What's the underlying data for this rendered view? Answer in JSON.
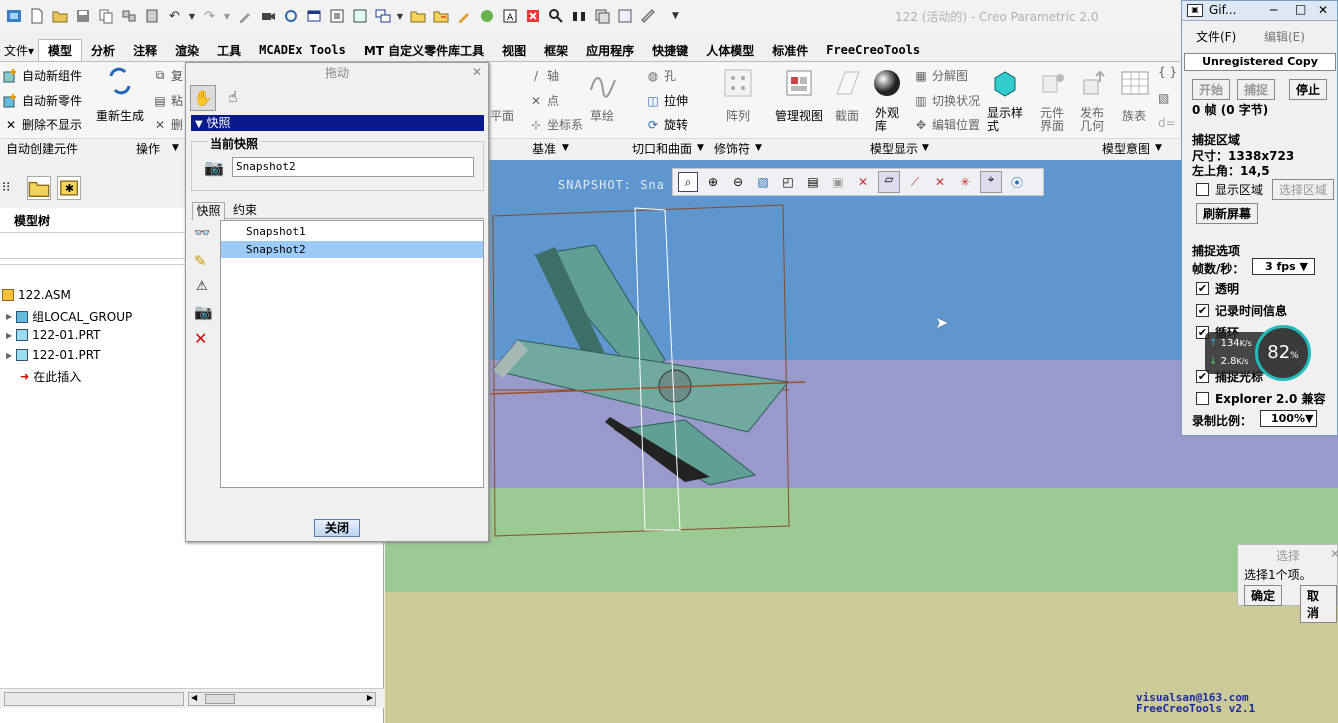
{
  "window": {
    "title": "122 (活动的) - Creo Parametric 2.0"
  },
  "tabs": [
    {
      "label": "文件▾"
    },
    {
      "label": "模型"
    },
    {
      "label": "分析"
    },
    {
      "label": "注释"
    },
    {
      "label": "渲染"
    },
    {
      "label": "工具"
    },
    {
      "label": "MCADEx Tools"
    },
    {
      "label": "MT 自定义零件库工具"
    },
    {
      "label": "视图"
    },
    {
      "label": "框架"
    },
    {
      "label": "应用程序"
    },
    {
      "label": "快捷键"
    },
    {
      "label": "人体模型"
    },
    {
      "label": "标准件"
    },
    {
      "label": "FreeCreoTools"
    }
  ],
  "ribbon": {
    "auto_new_component": "自动新组件",
    "auto_new_part": "自动新零件",
    "delete_hide": "删除不显示",
    "regenerate": "重新生成",
    "copy": "复",
    "paste": "粘",
    "delete": "删",
    "plane": "平面",
    "axis": "轴",
    "point": "点",
    "csys": "坐标系",
    "sketch": "草绘",
    "hole": "孔",
    "extrude": "拉伸",
    "revolve": "旋转",
    "pattern": "阵列",
    "manage_views": "管理视图",
    "section": "截面",
    "appearance": "外观库",
    "explode": "分解图",
    "toggle_status": "切换状况",
    "edit_position": "编辑位置",
    "display_style": "显示样式",
    "component_interface": "元件界面",
    "publish_geometry": "发布几何",
    "family_table": "族表",
    "d_eq": "d="
  },
  "groups": {
    "auto_create": "自动创建元件",
    "operations": "操作",
    "datum": "基准",
    "cut_surface": "切口和曲面",
    "modifiers": "修饰符",
    "model_display": "模型显示",
    "model_intent": "模型意图"
  },
  "left_panel": {
    "model_tree_label": "模型树",
    "items": [
      {
        "label": "122.ASM"
      },
      {
        "label": "组LOCAL_GROUP"
      },
      {
        "label": "122-01.PRT"
      },
      {
        "label": "122-01.PRT"
      },
      {
        "label": "在此插入"
      }
    ]
  },
  "drag_dialog": {
    "title": "拖动",
    "section": "快照",
    "current_snapshot_label": "当前快照",
    "current_snapshot_value": "Snapshot2",
    "tab_snapshots": "快照",
    "tab_constraints": "约束",
    "snapshots": [
      "Snapshot1",
      "Snapshot2"
    ],
    "close_label": "关闭"
  },
  "viewport": {
    "snapshot_text": "SNAPSHOT: Sna",
    "watermark_1": "visualsan@163.com",
    "watermark_2": "FreeCreoTools v2.1"
  },
  "gif": {
    "title": "Gif...",
    "menu_file": "文件(F)",
    "menu_edit": "编辑(E)",
    "unregistered": "Unregistered Copy",
    "start": "开始",
    "capture": "捕捉",
    "stop": "停止",
    "frames": "0 帧 (0 字节)",
    "capture_region": "捕捉区域",
    "size": "尺寸：1338x723",
    "topleft": "左上角：14,5",
    "show_region": "显示区域",
    "select_region": "选择区域",
    "refresh": "刷新屏幕",
    "capture_options": "捕捉选项",
    "fps_label": "帧数/秒：",
    "fps_value": "3 fps",
    "transparent": "透明",
    "record_time": "记录时间信息",
    "loop": "循环",
    "capture_cursor": "捕捉光标",
    "explorer_compat": "Explorer 2.0 兼容",
    "scale_label": "录制比例：",
    "scale_value": "100%"
  },
  "netmon": {
    "up": "134",
    "down": "2.8",
    "unit": "K/s",
    "percent": "82",
    "pct_sign": "%"
  },
  "select_dialog": {
    "title": "选择",
    "message": "选择1个项。",
    "ok": "确定",
    "cancel": "取消"
  }
}
